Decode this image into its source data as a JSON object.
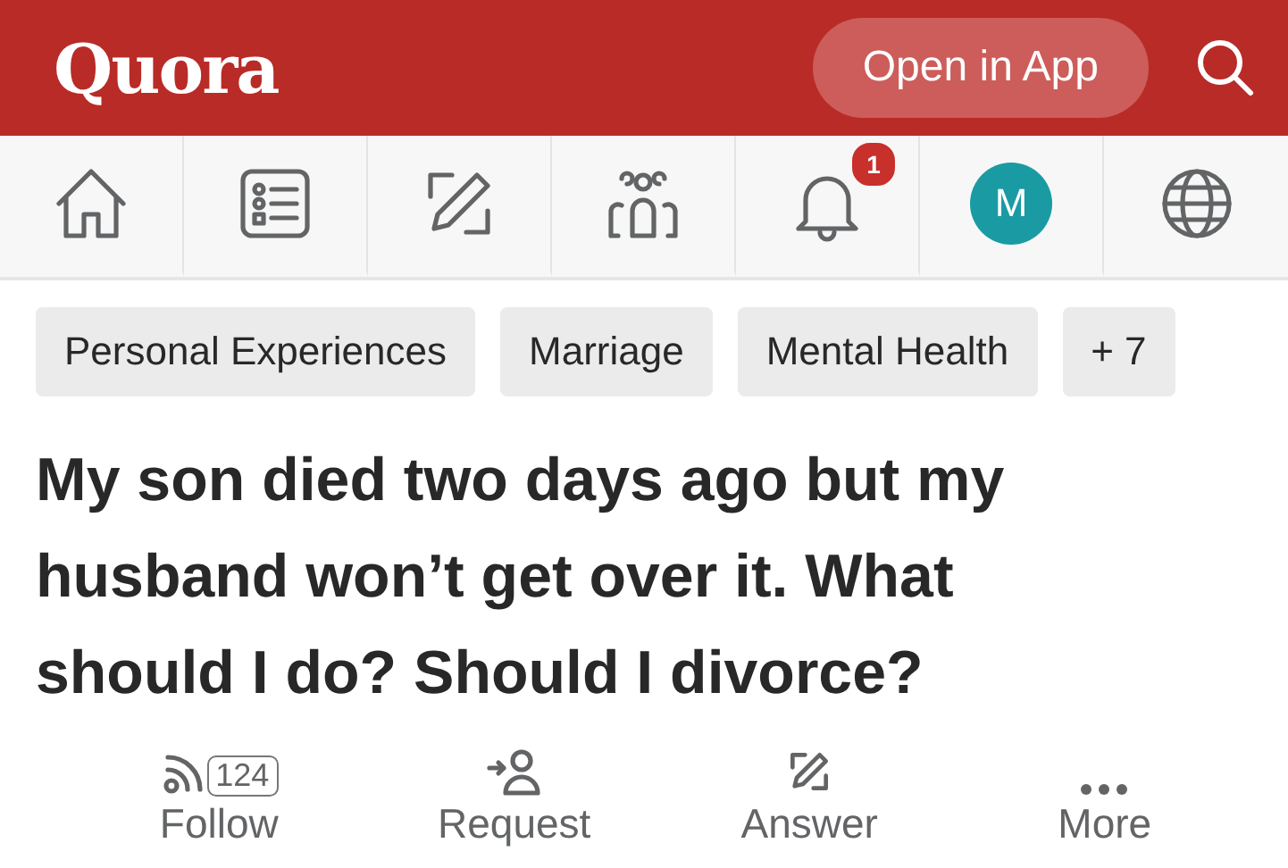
{
  "header": {
    "logo": "Quora",
    "open_app": "Open in App"
  },
  "nav": [
    {
      "kind": "home",
      "selected": false
    },
    {
      "kind": "list",
      "selected": false
    },
    {
      "kind": "write",
      "selected": false
    },
    {
      "kind": "people",
      "selected": false
    },
    {
      "kind": "bell",
      "selected": false,
      "badge": "1"
    },
    {
      "kind": "avatar",
      "selected": false,
      "initial": "M"
    },
    {
      "kind": "globe",
      "selected": false
    }
  ],
  "topics": [
    "Personal Experiences",
    "Marriage",
    "Mental Health",
    "+ 7"
  ],
  "question": "My son died two days ago but my husband won’t get over it. What should I do? Should I divorce?",
  "actions": [
    {
      "kind": "follow",
      "label": "Follow",
      "count": "124"
    },
    {
      "kind": "request",
      "label": "Request"
    },
    {
      "kind": "answer",
      "label": "Answer"
    },
    {
      "kind": "more",
      "label": "More"
    }
  ]
}
